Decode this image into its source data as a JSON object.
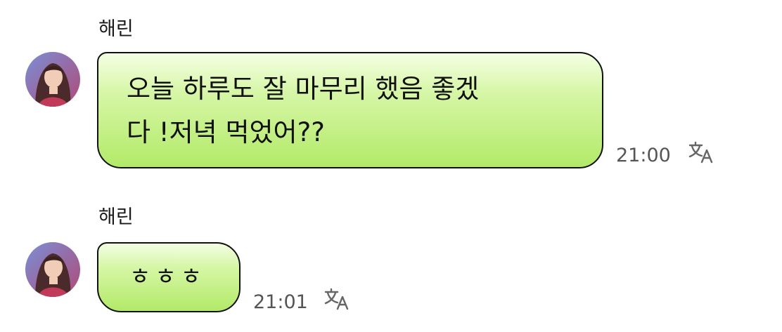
{
  "accent": {
    "bubble_top": "#f4ffe4",
    "bubble_bottom": "#b2ea68",
    "border": "#111111",
    "time": "#555555"
  },
  "messages": [
    {
      "sender": "해린",
      "text": "오늘 하루도 잘 마무리 했음 좋겠\n다 !저녁 먹었어??",
      "time": "21:00",
      "icon": "translate-icon"
    },
    {
      "sender": "해린",
      "text": "ㅎㅎㅎ",
      "time": "21:01",
      "icon": "translate-icon"
    }
  ]
}
